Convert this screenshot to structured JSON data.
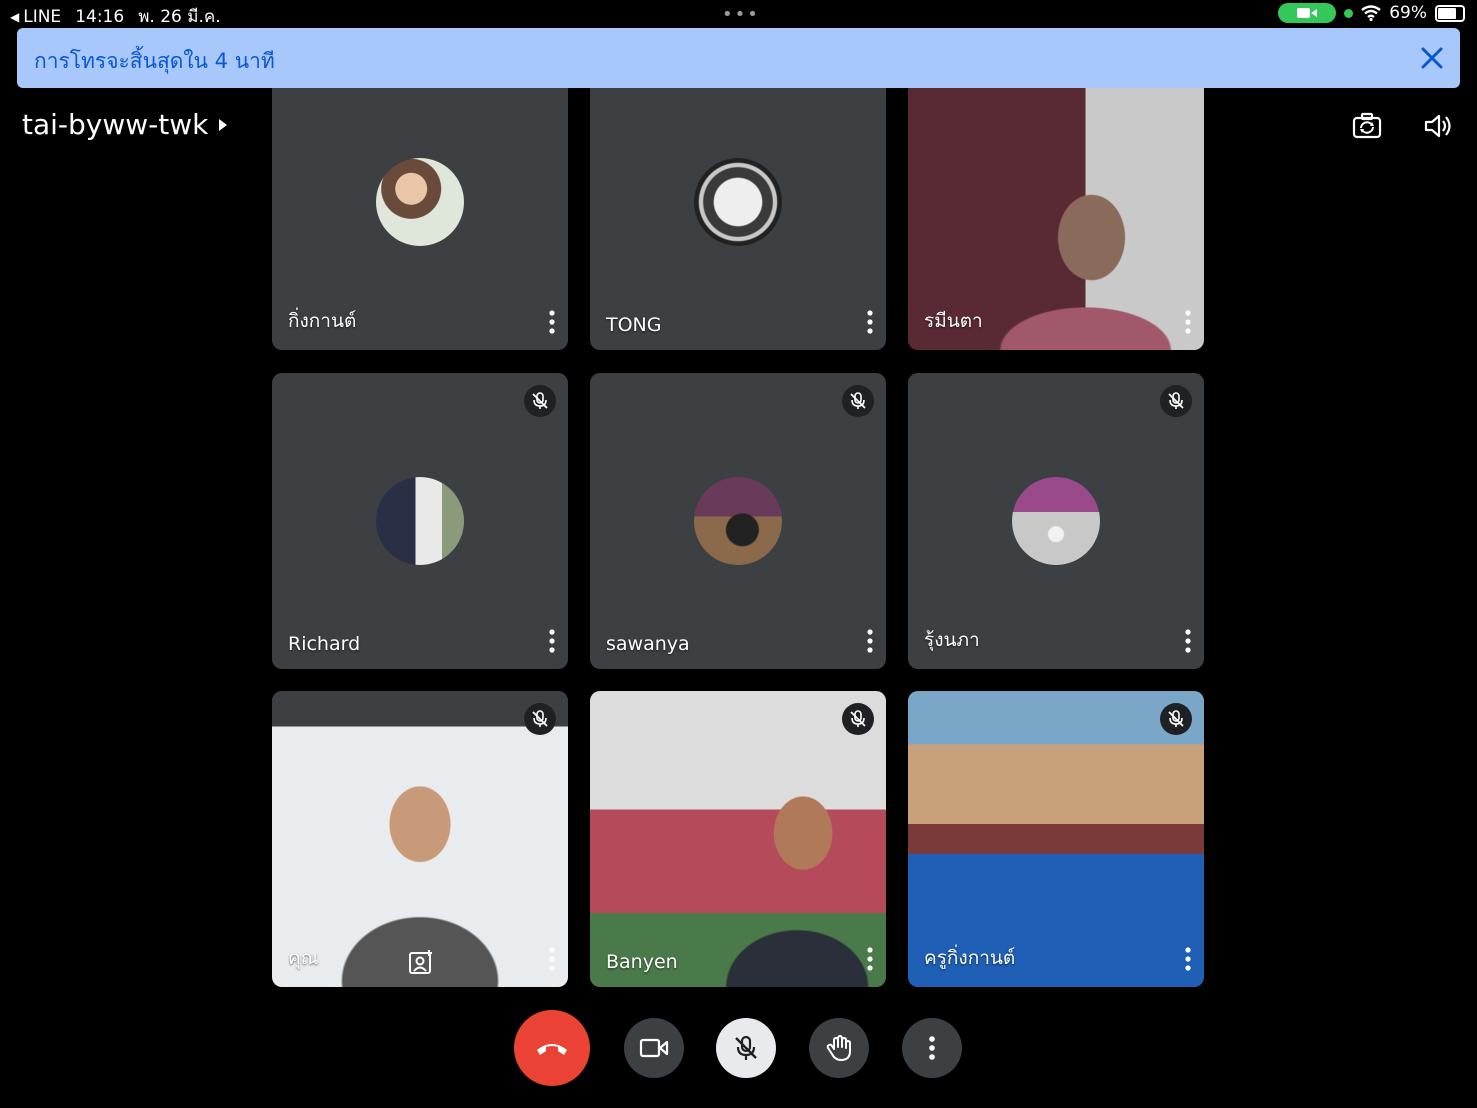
{
  "status_bar": {
    "back_app": "LINE",
    "time": "14:16",
    "date": "พ. 26 มี.ค.",
    "battery": "69%",
    "battery_level": 0.69
  },
  "banner": {
    "text": "การโทรจะสิ้นสุดใน 4 นาที",
    "background": "#a8c7fa",
    "text_color": "#0b57d0"
  },
  "meeting": {
    "code": "tai-byww-twk"
  },
  "participants": [
    {
      "name": "กิ่งกานต์",
      "view": "avatar",
      "muted": false
    },
    {
      "name": "TONG",
      "view": "avatar",
      "muted": false
    },
    {
      "name": "รมีนตา",
      "view": "video",
      "muted": false
    },
    {
      "name": "Richard",
      "view": "avatar",
      "muted": true
    },
    {
      "name": "sawanya",
      "view": "avatar",
      "muted": true
    },
    {
      "name": "รุ้งนภา",
      "view": "avatar",
      "muted": true
    },
    {
      "name": "คุณ",
      "view": "video",
      "muted": true
    },
    {
      "name": "Banyen",
      "view": "video",
      "muted": true
    },
    {
      "name": "ครูกิ่งกานต์",
      "view": "video",
      "muted": true
    }
  ],
  "controls": {
    "end_call_color": "#ea4335",
    "items": [
      "end-call-icon",
      "video-camera-icon",
      "mic-off-icon",
      "raise-hand-icon",
      "more-options-icon"
    ]
  },
  "colors": {
    "background": "#000000",
    "tile": "#3c4043"
  }
}
